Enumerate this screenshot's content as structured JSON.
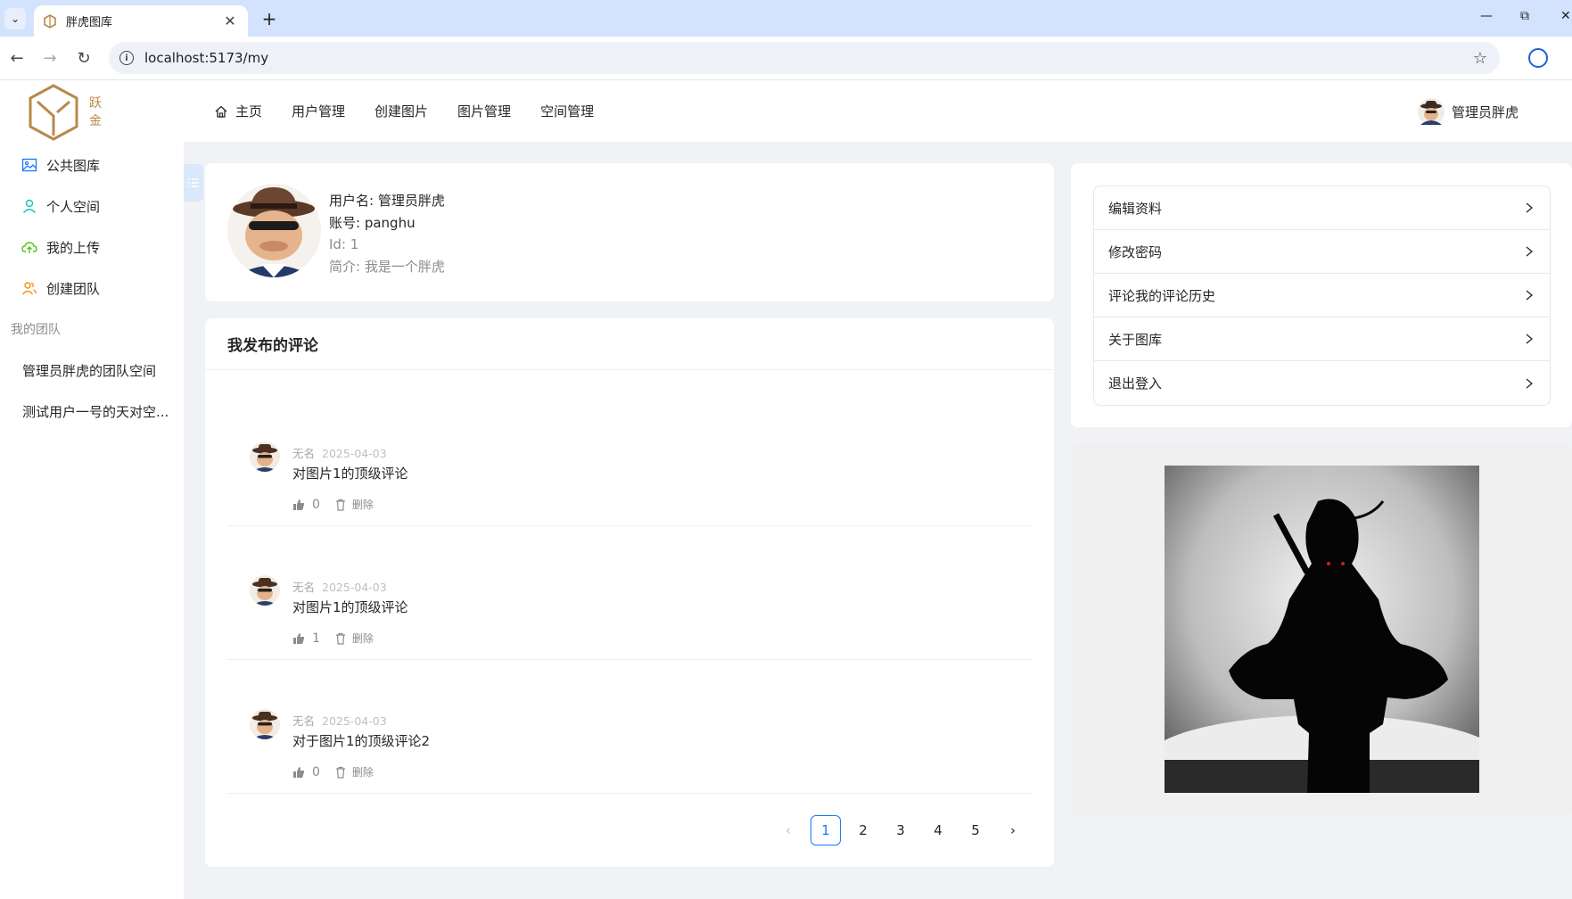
{
  "browser": {
    "tab_title": "胖虎图库",
    "url": "localhost:5173/my"
  },
  "header": {
    "logo_text_1": "跃",
    "logo_text_2": "金",
    "nav": [
      {
        "label": "主页"
      },
      {
        "label": "用户管理"
      },
      {
        "label": "创建图片"
      },
      {
        "label": "图片管理"
      },
      {
        "label": "空间管理"
      }
    ],
    "username": "管理员胖虎"
  },
  "sidebar": {
    "items": [
      {
        "label": "公共图库",
        "icon": "picture-icon"
      },
      {
        "label": "个人空间",
        "icon": "user-icon"
      },
      {
        "label": "我的上传",
        "icon": "cloud-upload-icon"
      },
      {
        "label": "创建团队",
        "icon": "team-icon"
      }
    ],
    "group_title": "我的团队",
    "teams": [
      {
        "label": "管理员胖虎的团队空间"
      },
      {
        "label": "测试用户一号的天对空..."
      }
    ]
  },
  "profile": {
    "username_line": "用户名: 管理员胖虎",
    "account_line": "账号: panghu",
    "id_line": "Id: 1",
    "bio_line": "简介: 我是一个胖虎"
  },
  "comments": {
    "title": "我发布的评论",
    "items": [
      {
        "author": "无名",
        "date": "2025-04-03",
        "content": "对图片1的顶级评论",
        "likes": "0",
        "delete_label": "删除"
      },
      {
        "author": "无名",
        "date": "2025-04-03",
        "content": "对图片1的顶级评论",
        "likes": "1",
        "delete_label": "删除"
      },
      {
        "author": "无名",
        "date": "2025-04-03",
        "content": "对于图片1的顶级评论2",
        "likes": "0",
        "delete_label": "删除"
      }
    ],
    "pagination": {
      "pages": [
        "1",
        "2",
        "3",
        "4",
        "5"
      ],
      "current": "1"
    }
  },
  "menu": {
    "items": [
      {
        "label": "编辑资料"
      },
      {
        "label": "修改密码"
      },
      {
        "label": "评论我的评论历史"
      },
      {
        "label": "关于图库"
      },
      {
        "label": "退出登入"
      }
    ]
  },
  "colors": {
    "accent": "#1677ff",
    "logo_gold": "#b8894a",
    "chrome_blue": "#d3e3fd"
  }
}
